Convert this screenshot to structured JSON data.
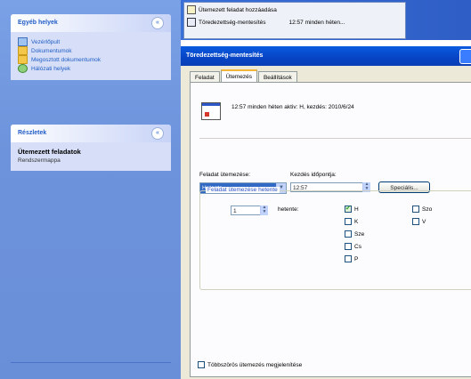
{
  "task_pane": {
    "other_places": {
      "title": "Egyéb helyek",
      "items": [
        {
          "label": "Vezérlőpult",
          "icon": "control-panel-icon"
        },
        {
          "label": "Dokumentumok",
          "icon": "folder-icon"
        },
        {
          "label": "Megosztott dokumentumok",
          "icon": "shared-folder-icon"
        },
        {
          "label": "Hálózati helyek",
          "icon": "network-icon"
        }
      ]
    },
    "details": {
      "title": "Részletek",
      "name": "Ütemezett feladatok",
      "type": "Rendszermappa"
    }
  },
  "notifications": [
    {
      "label": "Ütemezett feladat hozzáadása",
      "time": ""
    },
    {
      "label": "Töredezettség-mentesítés",
      "time": "12:57 minden héten..."
    }
  ],
  "dialog": {
    "title": "Töredezettség-mentesítés",
    "tabs": [
      "Feladat",
      "Ütemezés",
      "Beállítások"
    ],
    "active_tab": "Ütemezés",
    "summary": "12:57 minden héten aktiv: H, kezdés: 2010/6/24",
    "schedule_label": "Feladat ütemezése:",
    "schedule_value": "Hetente",
    "start_time_label": "Kezdés időpontja:",
    "start_time_value": "12:57",
    "special_button": "Speciális...",
    "weekly_group_title": "Feladat ütemezése hetente",
    "every_value": "1",
    "every_unit": "hetente:",
    "days": [
      {
        "label": "H",
        "checked": true
      },
      {
        "label": "K",
        "checked": false
      },
      {
        "label": "Sze",
        "checked": false
      },
      {
        "label": "Cs",
        "checked": false
      },
      {
        "label": "P",
        "checked": false
      },
      {
        "label": "Szo",
        "checked": false
      },
      {
        "label": "V",
        "checked": false
      }
    ],
    "multiple_schedules_label": "Többszörös ütemezés megjelenítése"
  }
}
